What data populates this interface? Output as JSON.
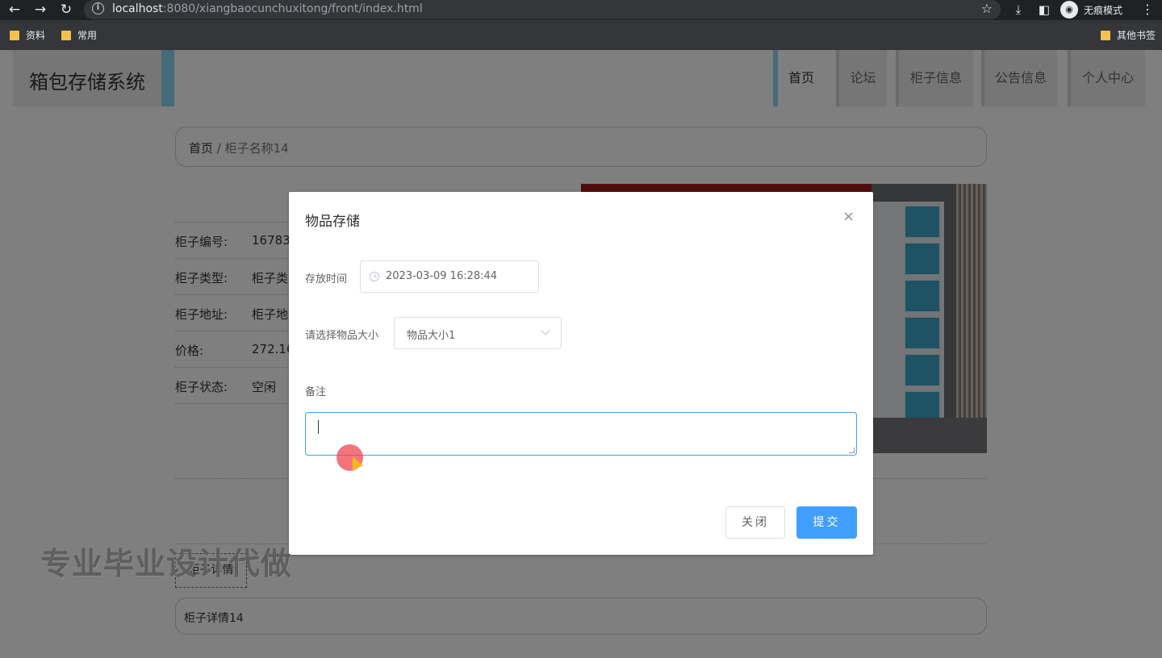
{
  "browser": {
    "url_host": "localhost",
    "url_path": ":8080/xiangbaocunchuxitong/front/index.html",
    "incognito_label": "无痕模式",
    "bookmarks": [
      "资料",
      "常用"
    ],
    "other_bookmarks": "其他书签"
  },
  "header": {
    "title": "箱包存储系统",
    "nav": [
      "首页",
      "论坛",
      "柜子信息",
      "公告信息",
      "个人中心"
    ]
  },
  "breadcrumb": {
    "home": "首页",
    "separator": " / ",
    "current": "柜子名称14"
  },
  "info": {
    "rows": [
      {
        "label": "柜子编号:",
        "value": "16783"
      },
      {
        "label": "柜子类型:",
        "value": "柜子类"
      },
      {
        "label": "柜子地址:",
        "value": "柜子地"
      },
      {
        "label": "价格:",
        "value": "272.16"
      },
      {
        "label": "柜子状态:",
        "value": "空闲"
      }
    ]
  },
  "tabs": {
    "detail_tab": "柜子详情"
  },
  "detail": {
    "text": "柜子详情14"
  },
  "dialog": {
    "title": "物品存储",
    "close_icon": "×",
    "time_label": "存放时间",
    "time_value": "2023-03-09 16:28:44",
    "size_label": "请选择物品大小",
    "size_value": "物品大小1",
    "remark_label": "备注",
    "remark_value": "",
    "close_button": "关闭",
    "submit_button": "提交"
  },
  "watermark": "专业毕业设计代做",
  "colors": {
    "primary": "#409eff",
    "accent": "#89d6f5"
  }
}
